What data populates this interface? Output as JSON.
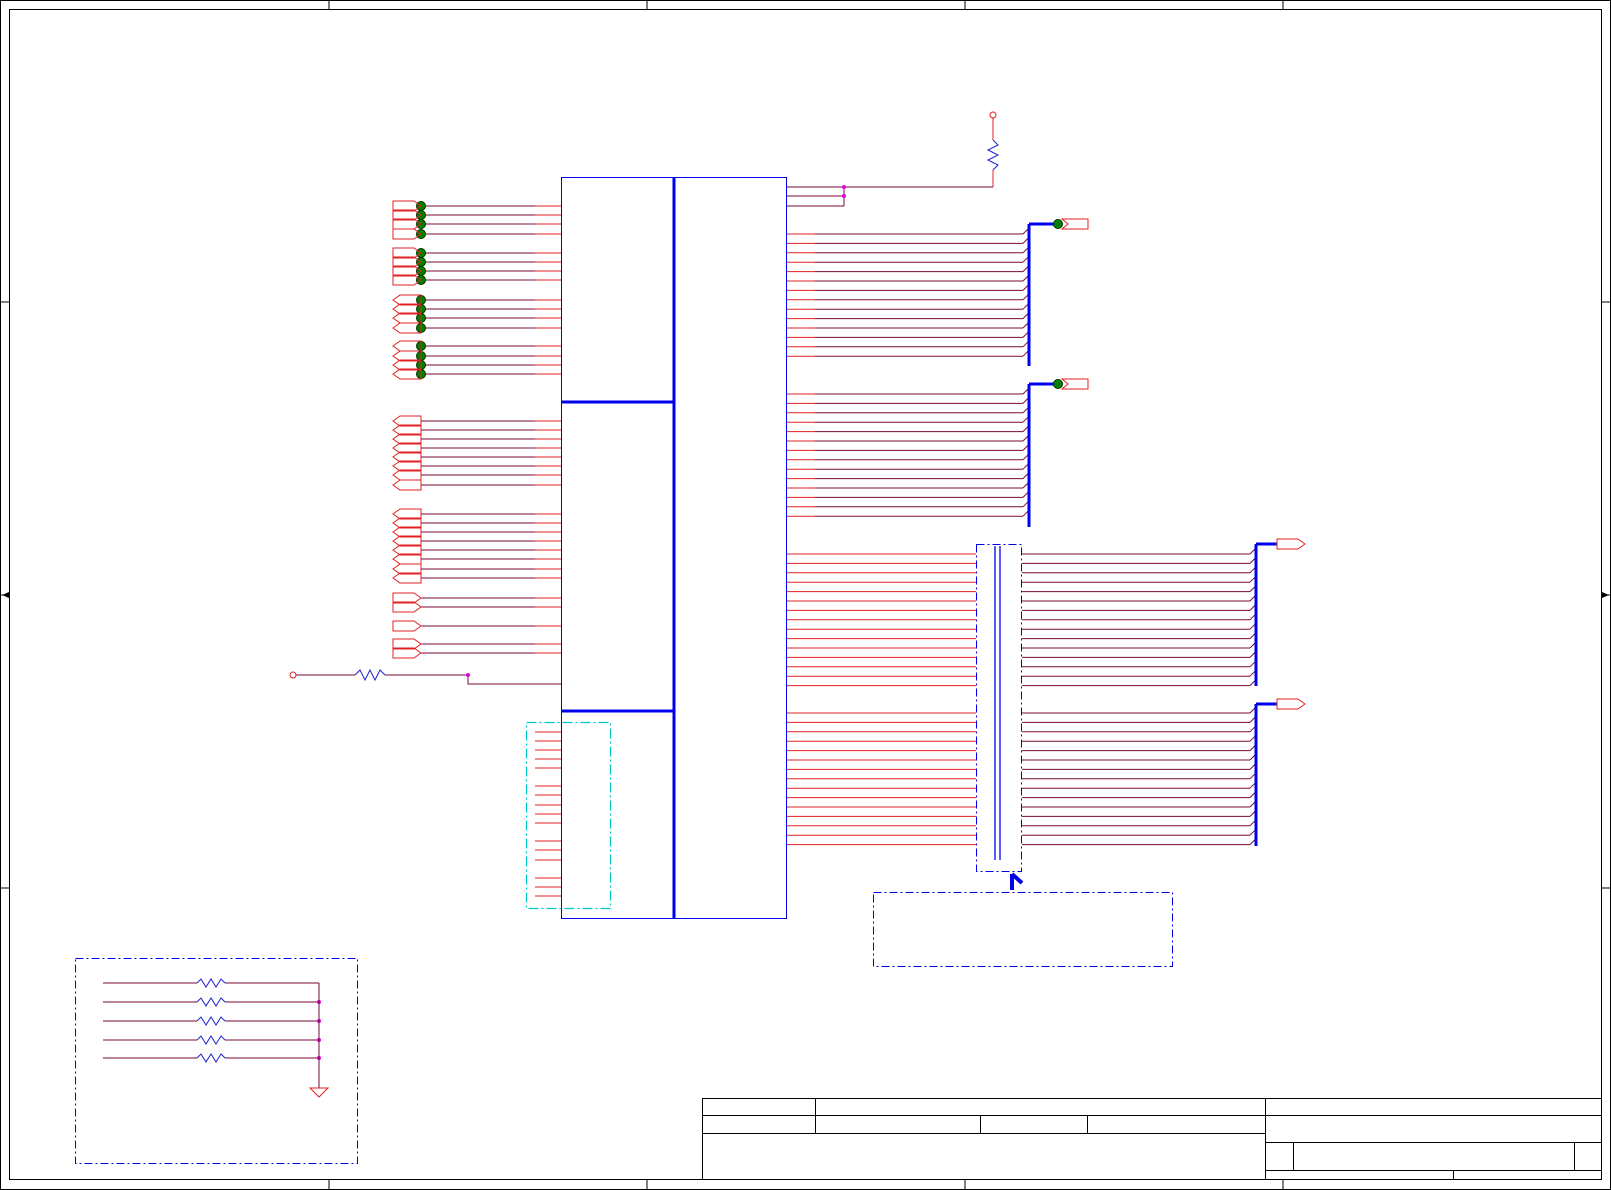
{
  "colors": {
    "wire": "#7a0a3a",
    "pin": "#e02020",
    "component": "#0000ee",
    "bus": "#0000ee",
    "junction_green": "#008000",
    "junction_magenta": "#e000e0",
    "highlight": "#00c8c8",
    "frame": "#000000",
    "resistor": "#2020d0"
  },
  "icons": {
    "connector": "off-page-connector-icon",
    "junction": "junction-dot-icon",
    "resistor": "resistor-icon",
    "ground": "ground-icon",
    "power": "power-pin-icon",
    "arrow": "callout-arrow-icon"
  },
  "title_block": {
    "cells": [
      "",
      "",
      "",
      "",
      "",
      "",
      ""
    ]
  }
}
